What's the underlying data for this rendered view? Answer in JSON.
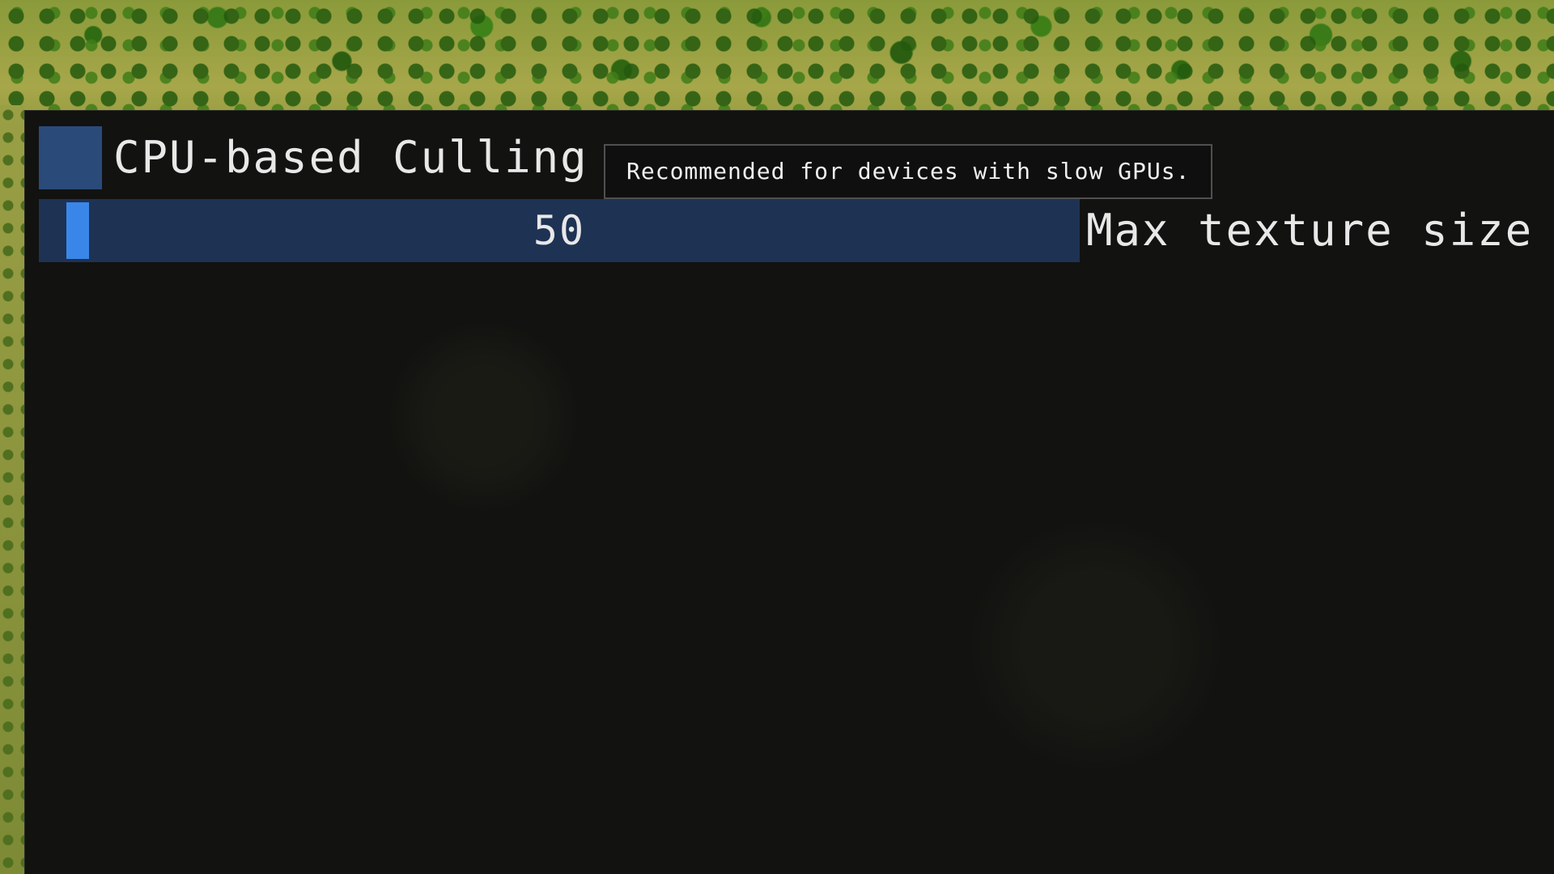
{
  "settings": {
    "cpu_culling": {
      "label": "CPU-based Culling",
      "checked": false,
      "tooltip": "Recommended for devices with slow GPUs."
    },
    "max_texture_size": {
      "label": "Max texture size",
      "value": "50",
      "fraction": 0.0
    }
  },
  "colors": {
    "checkbox_bg": "#2a4a7a",
    "slider_bg": "#1e3253",
    "slider_grab": "#3a86e8",
    "panel_bg": "#121210",
    "text": "#e8e8e8"
  },
  "icons": {
    "terrain": "forest-terrain-background"
  }
}
